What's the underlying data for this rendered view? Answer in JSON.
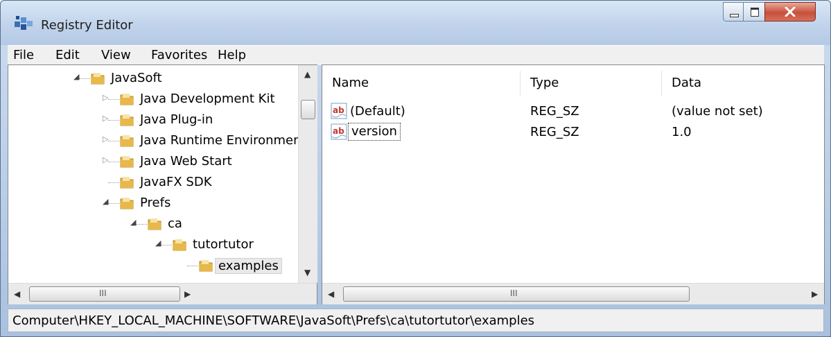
{
  "window": {
    "title": "Registry Editor"
  },
  "menu": [
    "File",
    "Edit",
    "View",
    "Favorites",
    "Help"
  ],
  "tree": [
    {
      "label": "JavaSoft",
      "expander": "expanded"
    },
    {
      "label": "Java Development Kit",
      "expander": "collapsed"
    },
    {
      "label": "Java Plug-in",
      "expander": "collapsed"
    },
    {
      "label": "Java Runtime Environmen",
      "expander": "collapsed"
    },
    {
      "label": "Java Web Start",
      "expander": "collapsed"
    },
    {
      "label": "JavaFX SDK",
      "expander": "none"
    },
    {
      "label": "Prefs",
      "expander": "expanded"
    },
    {
      "label": "ca",
      "expander": "expanded"
    },
    {
      "label": "tutortutor",
      "expander": "expanded"
    },
    {
      "label": "examples",
      "expander": "none",
      "selected": true
    }
  ],
  "list": {
    "columns": [
      "Name",
      "Type",
      "Data"
    ],
    "rows": [
      {
        "name": "(Default)",
        "type": "REG_SZ",
        "data": "(value not set)",
        "icon": "string-value-icon"
      },
      {
        "name": "version",
        "type": "REG_SZ",
        "data": "1.0",
        "icon": "string-value-icon",
        "focused": true
      }
    ]
  },
  "scrollbar_grip": "III",
  "status": {
    "path": "Computer\\HKEY_LOCAL_MACHINE\\SOFTWARE\\JavaSoft\\Prefs\\ca\\tutortutor\\examples"
  },
  "colors": {
    "folder": "#e8b84a",
    "ab_icon": "#c0392b"
  }
}
